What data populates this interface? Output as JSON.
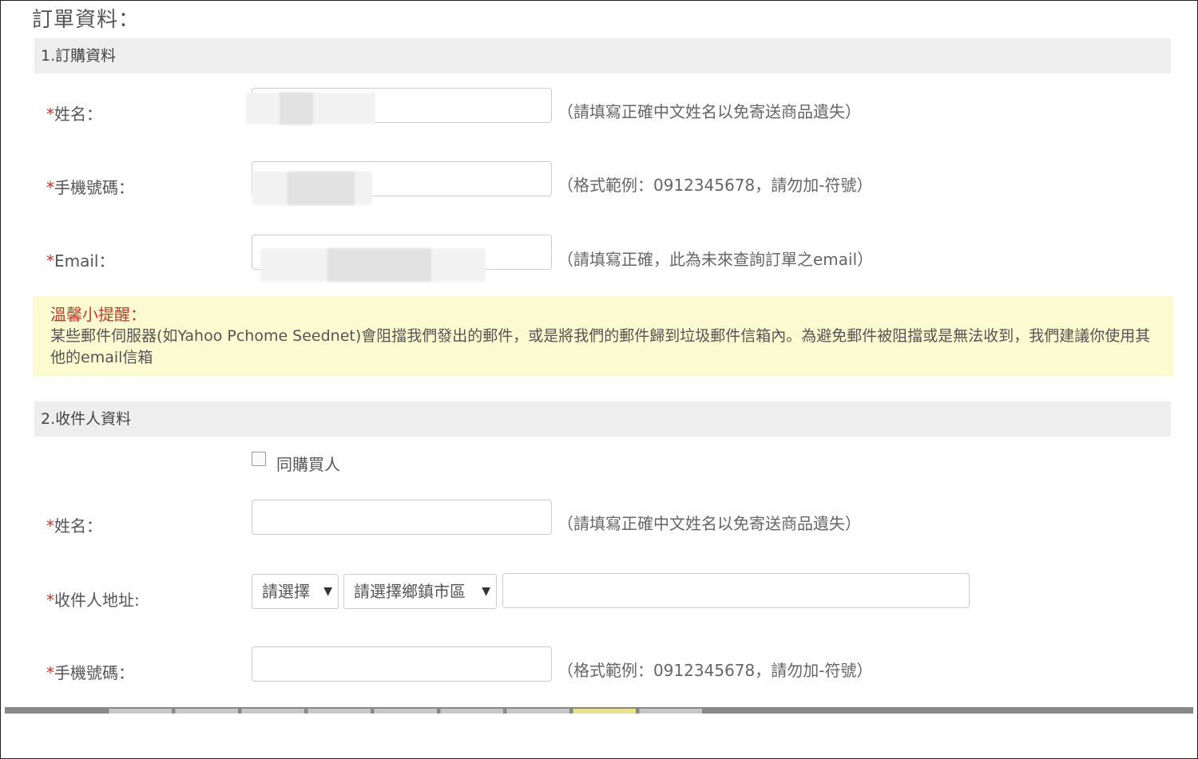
{
  "page_title": "訂單資料：",
  "section1": {
    "title": "1.訂購資料",
    "name": {
      "star": "*",
      "label": "姓名：",
      "hint": "（請填寫正確中文姓名以免寄送商品遺失）"
    },
    "phone": {
      "star": "*",
      "label": "手機號碼：",
      "hint": "（格式範例：0912345678，請勿加-符號）"
    },
    "email": {
      "star": "*",
      "label": "Email：",
      "hint": "（請填寫正確，此為未來查詢訂單之email）"
    }
  },
  "notice": {
    "title": "溫馨小提醒：",
    "text": "某些郵件伺服器(如Yahoo Pchome Seednet)會阻擋我們發出的郵件，或是將我們的郵件歸到垃圾郵件信箱內。為避免郵件被阻擋或是無法收到，我們建議你使用其他的email信箱"
  },
  "section2": {
    "title": "2.收件人資料",
    "same_as_buyer_label": "同購買人",
    "name": {
      "star": "*",
      "label": "姓名：",
      "hint": "（請填寫正確中文姓名以免寄送商品遺失）"
    },
    "address": {
      "star": "*",
      "label": "收件人地址:",
      "city_select": "請選擇",
      "district_select": "請選擇鄉鎮市區"
    },
    "phone": {
      "star": "*",
      "label": "手機號碼：",
      "hint": "（格式範例：0912345678，請勿加-符號）"
    }
  },
  "icons": {
    "select_arrow": "▼"
  },
  "colors": {
    "required_star": "#c0392b",
    "notice_bg": "#fbfad0",
    "section_bg": "#eeeeee"
  }
}
